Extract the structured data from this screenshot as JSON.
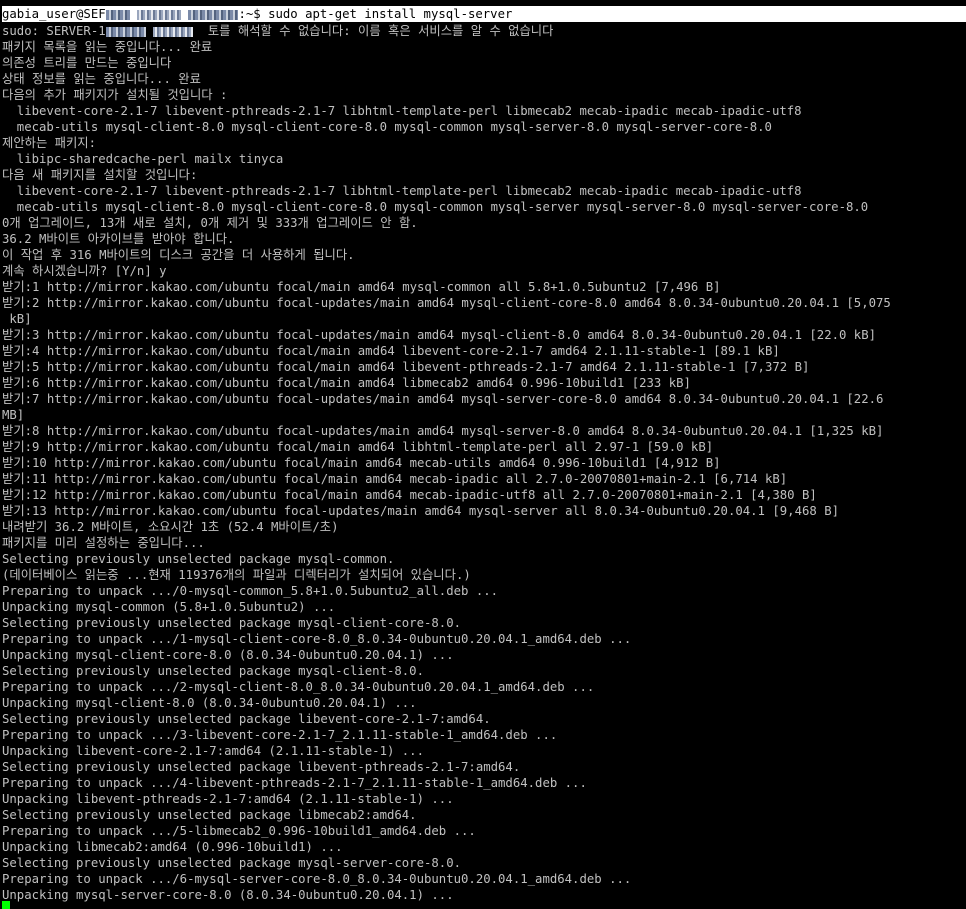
{
  "prompt": {
    "user_host": "gabia_user@SEF",
    "path_cmd": ":~$ sudo apt-get install mysql-server"
  },
  "sudo_line": {
    "prefix": "sudo: SERVER-1",
    "suffix": "  토를 해석할 수 없습니다: 이름 혹은 서비스를 알 수 없습니다"
  },
  "output": [
    "패키지 목록을 읽는 중입니다... 완료",
    "의존성 트리를 만드는 중입니다",
    "상태 정보를 읽는 중입니다... 완료",
    "다음의 추가 패키지가 설치될 것입니다 :",
    "  libevent-core-2.1-7 libevent-pthreads-2.1-7 libhtml-template-perl libmecab2 mecab-ipadic mecab-ipadic-utf8",
    "  mecab-utils mysql-client-8.0 mysql-client-core-8.0 mysql-common mysql-server-8.0 mysql-server-core-8.0",
    "제안하는 패키지:",
    "  libipc-sharedcache-perl mailx tinyca",
    "다음 새 패키지를 설치할 것입니다:",
    "  libevent-core-2.1-7 libevent-pthreads-2.1-7 libhtml-template-perl libmecab2 mecab-ipadic mecab-ipadic-utf8",
    "  mecab-utils mysql-client-8.0 mysql-client-core-8.0 mysql-common mysql-server mysql-server-8.0 mysql-server-core-8.0",
    "0개 업그레이드, 13개 새로 설치, 0개 제거 및 333개 업그레이드 안 함.",
    "36.2 M바이트 아카이브를 받아야 합니다.",
    "이 작업 후 316 M바이트의 디스크 공간을 더 사용하게 됩니다.",
    "계속 하시겠습니까? [Y/n] y",
    "받기:1 http://mirror.kakao.com/ubuntu focal/main amd64 mysql-common all 5.8+1.0.5ubuntu2 [7,496 B]",
    "받기:2 http://mirror.kakao.com/ubuntu focal-updates/main amd64 mysql-client-core-8.0 amd64 8.0.34-0ubuntu0.20.04.1 [5,075",
    " kB]",
    "받기:3 http://mirror.kakao.com/ubuntu focal-updates/main amd64 mysql-client-8.0 amd64 8.0.34-0ubuntu0.20.04.1 [22.0 kB]",
    "받기:4 http://mirror.kakao.com/ubuntu focal/main amd64 libevent-core-2.1-7 amd64 2.1.11-stable-1 [89.1 kB]",
    "받기:5 http://mirror.kakao.com/ubuntu focal/main amd64 libevent-pthreads-2.1-7 amd64 2.1.11-stable-1 [7,372 B]",
    "받기:6 http://mirror.kakao.com/ubuntu focal/main amd64 libmecab2 amd64 0.996-10build1 [233 kB]",
    "받기:7 http://mirror.kakao.com/ubuntu focal-updates/main amd64 mysql-server-core-8.0 amd64 8.0.34-0ubuntu0.20.04.1 [22.6",
    "MB]",
    "받기:8 http://mirror.kakao.com/ubuntu focal-updates/main amd64 mysql-server-8.0 amd64 8.0.34-0ubuntu0.20.04.1 [1,325 kB]",
    "받기:9 http://mirror.kakao.com/ubuntu focal/main amd64 libhtml-template-perl all 2.97-1 [59.0 kB]",
    "받기:10 http://mirror.kakao.com/ubuntu focal/main amd64 mecab-utils amd64 0.996-10build1 [4,912 B]",
    "받기:11 http://mirror.kakao.com/ubuntu focal/main amd64 mecab-ipadic all 2.7.0-20070801+main-2.1 [6,714 kB]",
    "받기:12 http://mirror.kakao.com/ubuntu focal/main amd64 mecab-ipadic-utf8 all 2.7.0-20070801+main-2.1 [4,380 B]",
    "받기:13 http://mirror.kakao.com/ubuntu focal-updates/main amd64 mysql-server all 8.0.34-0ubuntu0.20.04.1 [9,468 B]",
    "내려받기 36.2 M바이트, 소요시간 1초 (52.4 M바이트/초)",
    "패키지를 미리 설정하는 중입니다...",
    "Selecting previously unselected package mysql-common.",
    "(데이터베이스 읽는중 ...현재 119376개의 파일과 디렉터리가 설치되어 있습니다.)",
    "Preparing to unpack .../0-mysql-common_5.8+1.0.5ubuntu2_all.deb ...",
    "Unpacking mysql-common (5.8+1.0.5ubuntu2) ...",
    "Selecting previously unselected package mysql-client-core-8.0.",
    "Preparing to unpack .../1-mysql-client-core-8.0_8.0.34-0ubuntu0.20.04.1_amd64.deb ...",
    "Unpacking mysql-client-core-8.0 (8.0.34-0ubuntu0.20.04.1) ...",
    "Selecting previously unselected package mysql-client-8.0.",
    "Preparing to unpack .../2-mysql-client-8.0_8.0.34-0ubuntu0.20.04.1_amd64.deb ...",
    "Unpacking mysql-client-8.0 (8.0.34-0ubuntu0.20.04.1) ...",
    "Selecting previously unselected package libevent-core-2.1-7:amd64.",
    "Preparing to unpack .../3-libevent-core-2.1-7_2.1.11-stable-1_amd64.deb ...",
    "Unpacking libevent-core-2.1-7:amd64 (2.1.11-stable-1) ...",
    "Selecting previously unselected package libevent-pthreads-2.1-7:amd64.",
    "Preparing to unpack .../4-libevent-pthreads-2.1-7_2.1.11-stable-1_amd64.deb ...",
    "Unpacking libevent-pthreads-2.1-7:amd64 (2.1.11-stable-1) ...",
    "Selecting previously unselected package libmecab2:amd64.",
    "Preparing to unpack .../5-libmecab2_0.996-10build1_amd64.deb ...",
    "Unpacking libmecab2:amd64 (0.996-10build1) ...",
    "Selecting previously unselected package mysql-server-core-8.0.",
    "Preparing to unpack .../6-mysql-server-core-8.0_8.0.34-0ubuntu0.20.04.1_amd64.deb ...",
    "Unpacking mysql-server-core-8.0 (8.0.34-0ubuntu0.20.04.1) ..."
  ]
}
